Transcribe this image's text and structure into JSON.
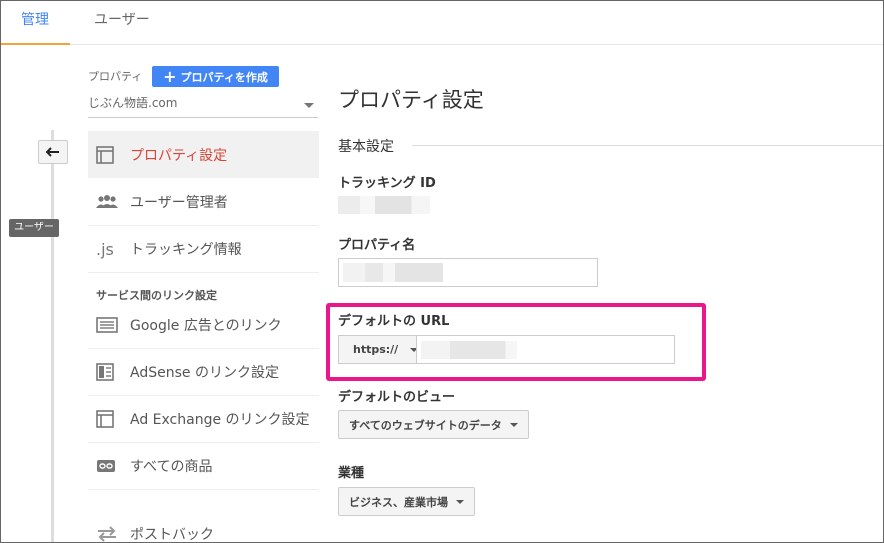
{
  "tabs": [
    {
      "label": "管理"
    },
    {
      "label": "ユーザー"
    }
  ],
  "rail": {
    "tag": "ユーザー"
  },
  "property": {
    "label": "プロパティ",
    "create_button": "プロパティを作成",
    "selected": "じぶん物語.com"
  },
  "nav": {
    "items": [
      {
        "label": "プロパティ設定"
      },
      {
        "label": "ユーザー管理者"
      },
      {
        "label": "トラッキング情報"
      },
      {
        "label": "Google 広告とのリンク"
      },
      {
        "label": "AdSense のリンク設定"
      },
      {
        "label": "Ad Exchange のリンク設定"
      },
      {
        "label": "すべての商品"
      },
      {
        "label": "ポストバック"
      }
    ],
    "section_label": "サービス間のリンク設定",
    "js_icon_text": ".js"
  },
  "content": {
    "title": "プロパティ設定",
    "section": "基本設定",
    "tracking_label": "トラッキング ID",
    "name_label": "プロパティ名",
    "default_url_label": "デフォルトの URL",
    "protocol": "https://",
    "default_view_label": "デフォルトのビュー",
    "default_view_value": "すべてのウェブサイトのデータ",
    "industry_label": "業種",
    "industry_value": "ビジネス、産業市場"
  },
  "colors": {
    "accent": "#4285f4",
    "active_nav": "#db4437",
    "highlight": "#e9168c",
    "tab_underline": "#f4a23a"
  }
}
